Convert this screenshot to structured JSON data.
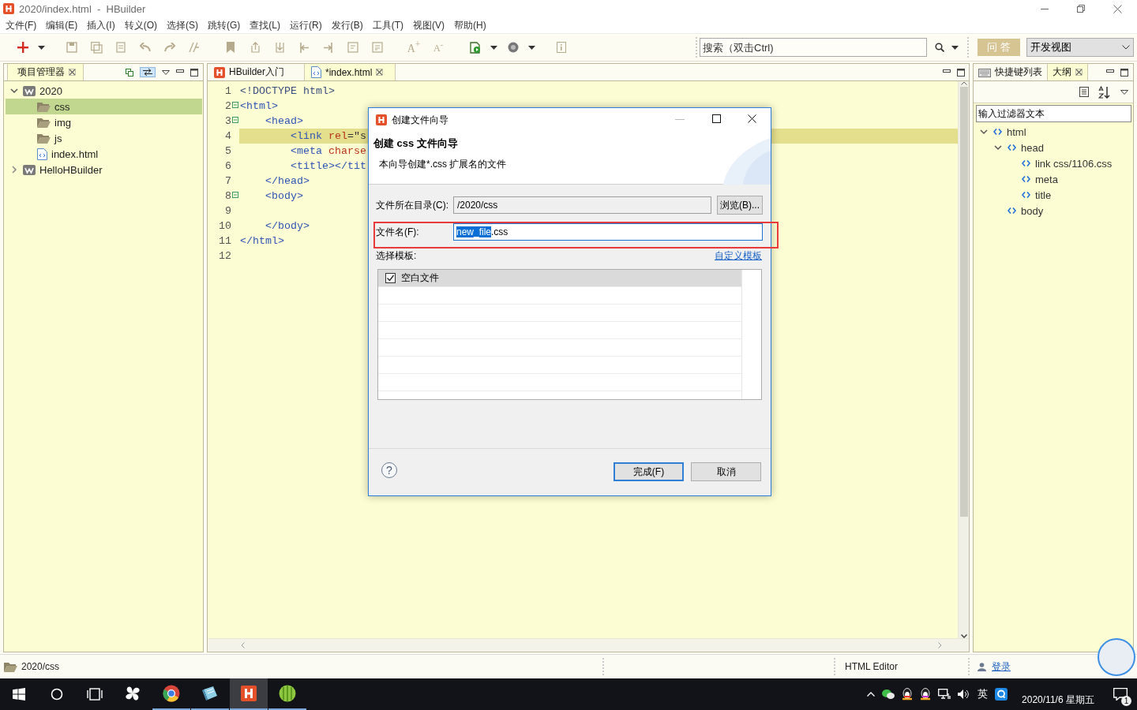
{
  "window": {
    "title": "2020/index.html  -  HBuilder"
  },
  "menu": [
    "文件(F)",
    "编辑(E)",
    "插入(I)",
    "转义(O)",
    "选择(S)",
    "跳转(G)",
    "查找(L)",
    "运行(R)",
    "发行(B)",
    "工具(T)",
    "视图(V)",
    "帮助(H)"
  ],
  "toolbar": {
    "font_buttons": [
      "A$^{+}$",
      "A$^{-}$"
    ],
    "search": {
      "placeholder": "搜索（双击Ctrl)"
    },
    "qa_button": "问 答",
    "perspective": "开发视图"
  },
  "project_pane": {
    "tabs": [
      {
        "label": "项目管理器",
        "selected": true
      }
    ],
    "link_with_editor": true,
    "tree": [
      {
        "label": "2020",
        "kind": "project",
        "expanded": true,
        "selected": false,
        "children": [
          {
            "label": "css",
            "kind": "folder",
            "selected": true
          },
          {
            "label": "img",
            "kind": "folder",
            "selected": false
          },
          {
            "label": "js",
            "kind": "folder",
            "selected": false
          },
          {
            "label": "index.html",
            "kind": "html",
            "selected": false
          }
        ]
      },
      {
        "label": "HelloHBuilder",
        "kind": "project",
        "expanded": false,
        "selected": false
      }
    ]
  },
  "editor": {
    "tabs": [
      {
        "label": "HBuilder入门",
        "kind": "app",
        "selected": false
      },
      {
        "label": "*index.html",
        "kind": "html",
        "selected": true
      }
    ],
    "lines": [
      {
        "number": "1",
        "foldable": false,
        "current": false,
        "tokens": [
          {
            "kind": "doctype",
            "text": "<!DOCTYPE html>"
          }
        ]
      },
      {
        "number": "2",
        "foldable": true,
        "current": false,
        "tokens": [
          {
            "kind": "tag",
            "text": "<html>"
          }
        ]
      },
      {
        "number": "3",
        "foldable": true,
        "current": false,
        "tokens": [
          {
            "kind": "tag",
            "text": "    <head>"
          }
        ]
      },
      {
        "number": "4",
        "foldable": false,
        "current": true,
        "tokens": [
          {
            "kind": "tag",
            "text": "        <link"
          },
          {
            "kind": "attr",
            "text": " rel"
          },
          {
            "kind": "plain",
            "text": "=\"s"
          }
        ]
      },
      {
        "number": "5",
        "foldable": false,
        "current": false,
        "tokens": [
          {
            "kind": "tag",
            "text": "        <meta"
          },
          {
            "kind": "attr",
            "text": " charse"
          }
        ]
      },
      {
        "number": "6",
        "foldable": false,
        "current": false,
        "tokens": [
          {
            "kind": "tag",
            "text": "        <title></tit"
          }
        ]
      },
      {
        "number": "7",
        "foldable": false,
        "current": false,
        "tokens": [
          {
            "kind": "tag",
            "text": "    </head>"
          }
        ]
      },
      {
        "number": "8",
        "foldable": true,
        "current": false,
        "tokens": [
          {
            "kind": "tag",
            "text": "    <body>"
          }
        ]
      },
      {
        "number": "9",
        "foldable": false,
        "current": false
      },
      {
        "number": "10",
        "foldable": false,
        "current": false,
        "tokens": [
          {
            "kind": "tag",
            "text": "    </body>"
          }
        ]
      },
      {
        "number": "11",
        "foldable": false,
        "current": false,
        "tokens": [
          {
            "kind": "tag",
            "text": "</html>"
          }
        ]
      },
      {
        "number": "12",
        "foldable": false,
        "current": false
      }
    ]
  },
  "dialog": {
    "title": "创建文件向导",
    "heading": "创建 css 文件向导",
    "description": "本向导创建*.css 扩展名的文件",
    "directory": {
      "label": "文件所在目录(C):",
      "value": "/2020/css"
    },
    "browse_button": "浏览(B)...",
    "filename": {
      "label": "文件名(F):",
      "highlighted": true,
      "value_parts": [
        {
          "text": "new_file",
          "selected": true
        },
        {
          "text": ".css",
          "selected": false
        }
      ]
    },
    "template_label": "选择模板:",
    "custom_template_link": "自定义模板",
    "templates": [
      {
        "label": "空白文件",
        "checked": true,
        "selected": true
      }
    ],
    "help_button": "?",
    "buttons": [
      {
        "label": "完成(F)",
        "default": true
      },
      {
        "label": "取消",
        "default": false
      }
    ]
  },
  "outline_pane": {
    "tabs": [
      {
        "label": "快捷键列表",
        "kind": "keys",
        "selected": false
      },
      {
        "label": "大纲",
        "kind": "outline",
        "selected": true
      }
    ],
    "filter": {
      "placeholder": "输入过滤器文本"
    },
    "tree": [
      {
        "label": "html",
        "expanded": true,
        "children": [
          {
            "label": "head",
            "expanded": true,
            "children": [
              {
                "label": "link css/1106.css"
              },
              {
                "label": "meta"
              },
              {
                "label": "title"
              }
            ]
          },
          {
            "label": "body"
          }
        ]
      }
    ]
  },
  "status_bar": {
    "path": "2020/css",
    "editor_type": "HTML Editor",
    "login_link": "登录"
  },
  "taskbar": {
    "apps": [
      {
        "kind": "pinwheel",
        "running": false,
        "active": false
      },
      {
        "kind": "browser",
        "running": true,
        "active": false
      },
      {
        "kind": "notebook",
        "running": true,
        "active": false
      },
      {
        "kind": "hbuilder",
        "running": true,
        "active": true
      },
      {
        "kind": "ball",
        "running": true,
        "active": false
      }
    ],
    "ime": "英",
    "date": "2020/11/6 星期五",
    "notification_count": "1"
  }
}
